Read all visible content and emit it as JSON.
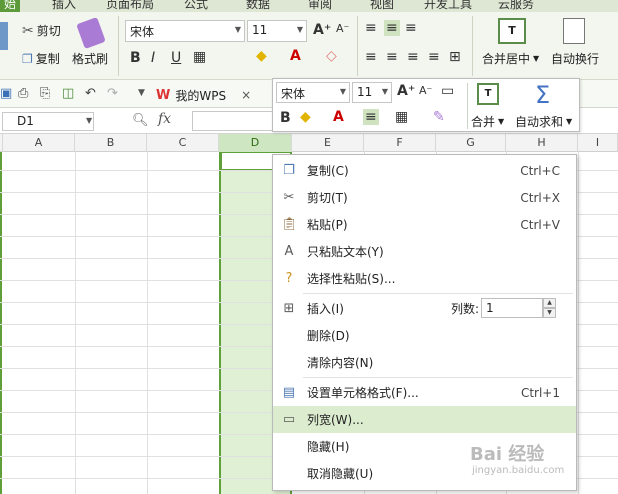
{
  "menu_tabs": [
    "始",
    "插入",
    "页面布局",
    "公式",
    "数据",
    "审阅",
    "视图",
    "开发工具",
    "云服务"
  ],
  "ribbon": {
    "cut_label": "剪切",
    "copy_label": "复制",
    "format_painter_label": "格式刷",
    "font_name": "宋体",
    "font_size": "11",
    "bold": "B",
    "italic": "I",
    "underline": "U",
    "merge_center_label": "合并居中",
    "wrap_text_label": "自动换行",
    "merge_icon_text": "T"
  },
  "quickbar": {
    "doc_tab_label": "我的WPS",
    "doc_tab_close": "×"
  },
  "formula_bar": {
    "name_box": "D1",
    "fx": "fx"
  },
  "mini_toolbar": {
    "font_name": "宋体",
    "font_size": "11",
    "bold": "B",
    "merge_label": "合并",
    "autosum_label": "自动求和",
    "merge_icon_text": "T",
    "autosum_icon": "Σ"
  },
  "columns": [
    "A",
    "B",
    "C",
    "D",
    "E",
    "F",
    "G",
    "H",
    "I"
  ],
  "selected_column": "D",
  "context_menu": {
    "items": [
      {
        "label": "复制(C)",
        "shortcut": "Ctrl+C",
        "icon": "copy-icon"
      },
      {
        "label": "剪切(T)",
        "shortcut": "Ctrl+X",
        "icon": "scissors-icon"
      },
      {
        "label": "粘贴(P)",
        "shortcut": "Ctrl+V",
        "icon": "paste-icon"
      },
      {
        "label": "只粘贴文本(Y)",
        "shortcut": "",
        "icon": "paste-text-icon"
      },
      {
        "label": "选择性粘贴(S)...",
        "shortcut": "",
        "icon": "paste-special-icon"
      },
      {
        "label": "插入(I)",
        "shortcut": "",
        "icon": "insert-icon"
      },
      {
        "label": "删除(D)",
        "shortcut": "",
        "icon": ""
      },
      {
        "label": "清除内容(N)",
        "shortcut": "",
        "icon": ""
      },
      {
        "label": "设置单元格格式(F)...",
        "shortcut": "Ctrl+1",
        "icon": "format-cells-icon"
      },
      {
        "label": "列宽(W)...",
        "shortcut": "",
        "icon": "column-width-icon"
      },
      {
        "label": "隐藏(H)",
        "shortcut": "",
        "icon": ""
      },
      {
        "label": "取消隐藏(U)",
        "shortcut": "",
        "icon": ""
      }
    ],
    "columns_count_label": "列数:",
    "columns_count_value": "1"
  },
  "watermark": {
    "main": "Bai 经验",
    "sub": "jingyan.baidu.com"
  },
  "colors": {
    "accent": "#5fa03a",
    "selection_fill": "#dff0d4",
    "highlight": "#dceccf"
  }
}
